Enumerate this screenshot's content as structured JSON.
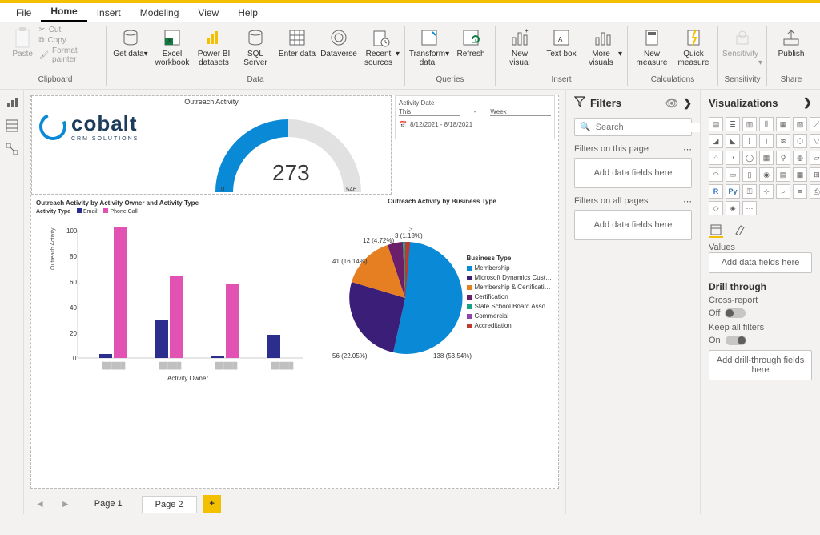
{
  "menu": {
    "file": "File",
    "home": "Home",
    "insert": "Insert",
    "modeling": "Modeling",
    "view": "View",
    "help": "Help"
  },
  "ribbon": {
    "clipboard": {
      "paste": "Paste",
      "cut": "Cut",
      "copy": "Copy",
      "format_painter": "Format painter",
      "label": "Clipboard"
    },
    "data": {
      "get_data": "Get data",
      "excel": "Excel workbook",
      "pbi_ds": "Power BI datasets",
      "sql": "SQL Server",
      "enter": "Enter data",
      "dataverse": "Dataverse",
      "recent": "Recent sources",
      "label": "Data"
    },
    "queries": {
      "transform": "Transform data",
      "refresh": "Refresh",
      "label": "Queries"
    },
    "insert": {
      "new_visual": "New visual",
      "text_box": "Text box",
      "more_visuals": "More visuals",
      "label": "Insert"
    },
    "calc": {
      "new_measure": "New measure",
      "quick_measure": "Quick measure",
      "label": "Calculations"
    },
    "sens": {
      "sensitivity": "Sensitivity",
      "label": "Sensitivity"
    },
    "share": {
      "publish": "Publish",
      "label": "Share"
    }
  },
  "filters_pane": {
    "title": "Filters",
    "search_placeholder": "Search",
    "page_filters": "Filters on this page",
    "all_filters": "Filters on all pages",
    "add_fields": "Add data fields here"
  },
  "viz_pane": {
    "title": "Visualizations",
    "values": "Values",
    "add_fields": "Add data fields here",
    "drill": "Drill through",
    "cross_report": "Cross-report",
    "off": "Off",
    "keep_filters": "Keep all filters",
    "on": "On",
    "add_drill": "Add drill-through fields here"
  },
  "tabs": {
    "page1": "Page 1",
    "page2": "Page 2"
  },
  "canvas": {
    "logo_text": "cobalt",
    "logo_sub": "CRM SOLUTIONS",
    "gauge": {
      "title": "Outreach Activity",
      "value": "273",
      "min": "0",
      "max": "546"
    },
    "date_filter": {
      "title": "Activity Date",
      "field1": "This",
      "field2": "Week",
      "range": "8/12/2021 - 8/18/2021"
    },
    "bar_chart": {
      "title": "Outreach Activity by Activity Owner and Activity Type",
      "legend_title": "Activity Type",
      "legend_email": "Email",
      "legend_phone": "Phone Call",
      "y_label": "Outreach Activity",
      "x_label": "Activity Owner"
    },
    "pie_chart": {
      "title": "Outreach Activity by Business Type",
      "legend_title": "Business Type",
      "items": {
        "membership": "Membership",
        "msdyn": "Microsoft Dynamics Cust…",
        "mem_cert": "Membership & Certificati…",
        "cert": "Certification",
        "school": "State School Board Asso…",
        "commercial": "Commercial",
        "accred": "Accreditation"
      },
      "labels": {
        "l138": "138 (53.54%)",
        "l56": "56 (22.05%)",
        "l41": "41 (16.14%)",
        "l12": "12 (4.72%)",
        "l3_1": "3 (1.18%)",
        "l3_2": "3"
      }
    }
  },
  "chart_data": [
    {
      "type": "gauge",
      "title": "Outreach Activity",
      "value": 273,
      "min": 0,
      "max": 546
    },
    {
      "type": "bar",
      "title": "Outreach Activity by Activity Owner and Activity Type",
      "xlabel": "Activity Owner",
      "ylabel": "Outreach Activity",
      "ylim": [
        0,
        100
      ],
      "categories": [
        "Owner 1",
        "Owner 2",
        "Owner 3",
        "Owner 4"
      ],
      "series": [
        {
          "name": "Email",
          "values": [
            3,
            30,
            2,
            18
          ]
        },
        {
          "name": "Phone Call",
          "values": [
            103,
            64,
            58,
            0
          ]
        }
      ]
    },
    {
      "type": "pie",
      "title": "Outreach Activity by Business Type",
      "categories": [
        "Membership",
        "Microsoft Dynamics Customer",
        "Membership & Certification",
        "Certification",
        "State School Board Association",
        "Commercial",
        "Accreditation"
      ],
      "values": [
        138,
        56,
        41,
        12,
        3,
        3,
        3
      ],
      "percentages": [
        53.54,
        22.05,
        16.14,
        4.72,
        1.18,
        1.18,
        1.18
      ]
    }
  ]
}
